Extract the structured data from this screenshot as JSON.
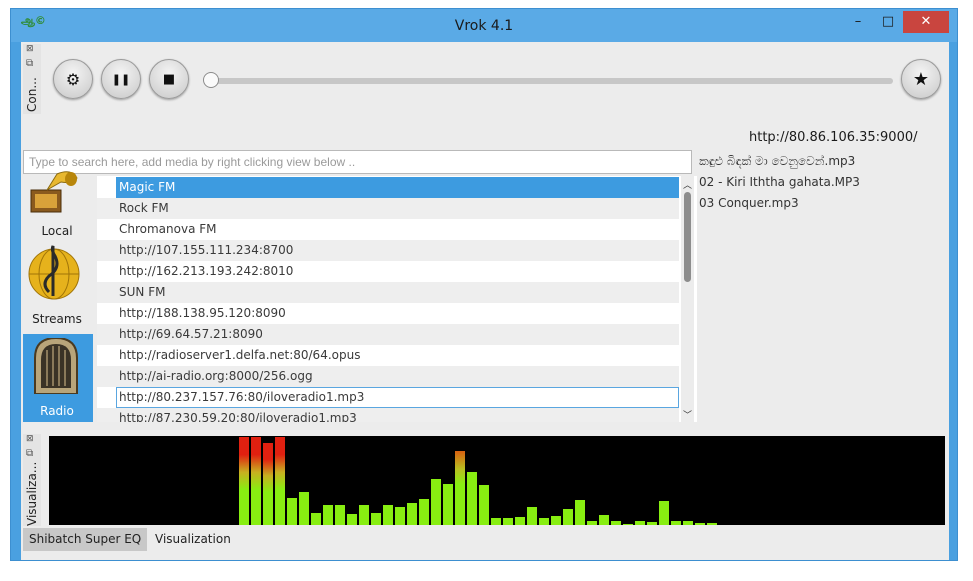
{
  "window": {
    "title": "Vrok 4.1",
    "app_icon_text": "ஆ©"
  },
  "titlebar": {
    "minimize": "–",
    "maximize": "□",
    "close": "✕"
  },
  "control_dock": {
    "label": "Con...",
    "close_glyph": "⊠",
    "float_glyph": "⧉"
  },
  "controls": {
    "settings_glyph": "⚙",
    "pause_glyph": "❚❚",
    "stop_glyph": "■",
    "favorite_glyph": "★",
    "seek_progress": 0.0
  },
  "now_playing_url": "http://80.86.106.35:9000/",
  "search": {
    "placeholder": "Type to search here, add media by right clicking view below .."
  },
  "sidebar": {
    "items": [
      {
        "label": "Local",
        "icon": "gramophone-icon"
      },
      {
        "label": "Streams",
        "icon": "treble-clef-icon"
      },
      {
        "label": "Radio",
        "icon": "radio-icon"
      }
    ],
    "active": "Radio"
  },
  "stations": [
    "Magic FM",
    "Rock FM",
    "Chromanova FM",
    "http://107.155.111.234:8700",
    "http://162.213.193.242:8010",
    "SUN FM",
    "http://188.138.95.120:8090",
    "http://69.64.57.21:8090",
    "http://radioserver1.delfa.net:80/64.opus",
    "http://ai-radio.org:8000/256.ogg",
    "http://80.237.157.76:80/iloveradio1.mp3",
    "http://87.230.59.20:80/iloveradio1.mp3"
  ],
  "selected_station": "Magic FM",
  "focused_station": "http://80.237.157.76:80/iloveradio1.mp3",
  "playlist": [
    "කඳුළු බිඳක් මා වෙනුවෙන්.mp3",
    "02 - Kiri Iththa gahata.MP3",
    "03 Conquer.mp3"
  ],
  "visualization_dock": {
    "label": "Visualiza..."
  },
  "visualizer_levels": [
    0.99,
    0.99,
    0.92,
    0.99,
    0.3,
    0.37,
    0.13,
    0.23,
    0.23,
    0.12,
    0.23,
    0.14,
    0.22,
    0.2,
    0.25,
    0.29,
    0.52,
    0.46,
    0.83,
    0.6,
    0.45,
    0.08,
    0.08,
    0.09,
    0.2,
    0.08,
    0.1,
    0.18,
    0.28,
    0.05,
    0.11,
    0.05,
    0.01,
    0.04,
    0.03,
    0.27,
    0.04,
    0.04,
    0.02,
    0.02
  ],
  "colors": {
    "accent": "#3d9be0",
    "bar_green": "#88ee11",
    "bar_red": "#e02010"
  },
  "bottom_tabs": [
    {
      "label": "Shibatch Super EQ",
      "active": true
    },
    {
      "label": "Visualization",
      "active": false
    }
  ]
}
